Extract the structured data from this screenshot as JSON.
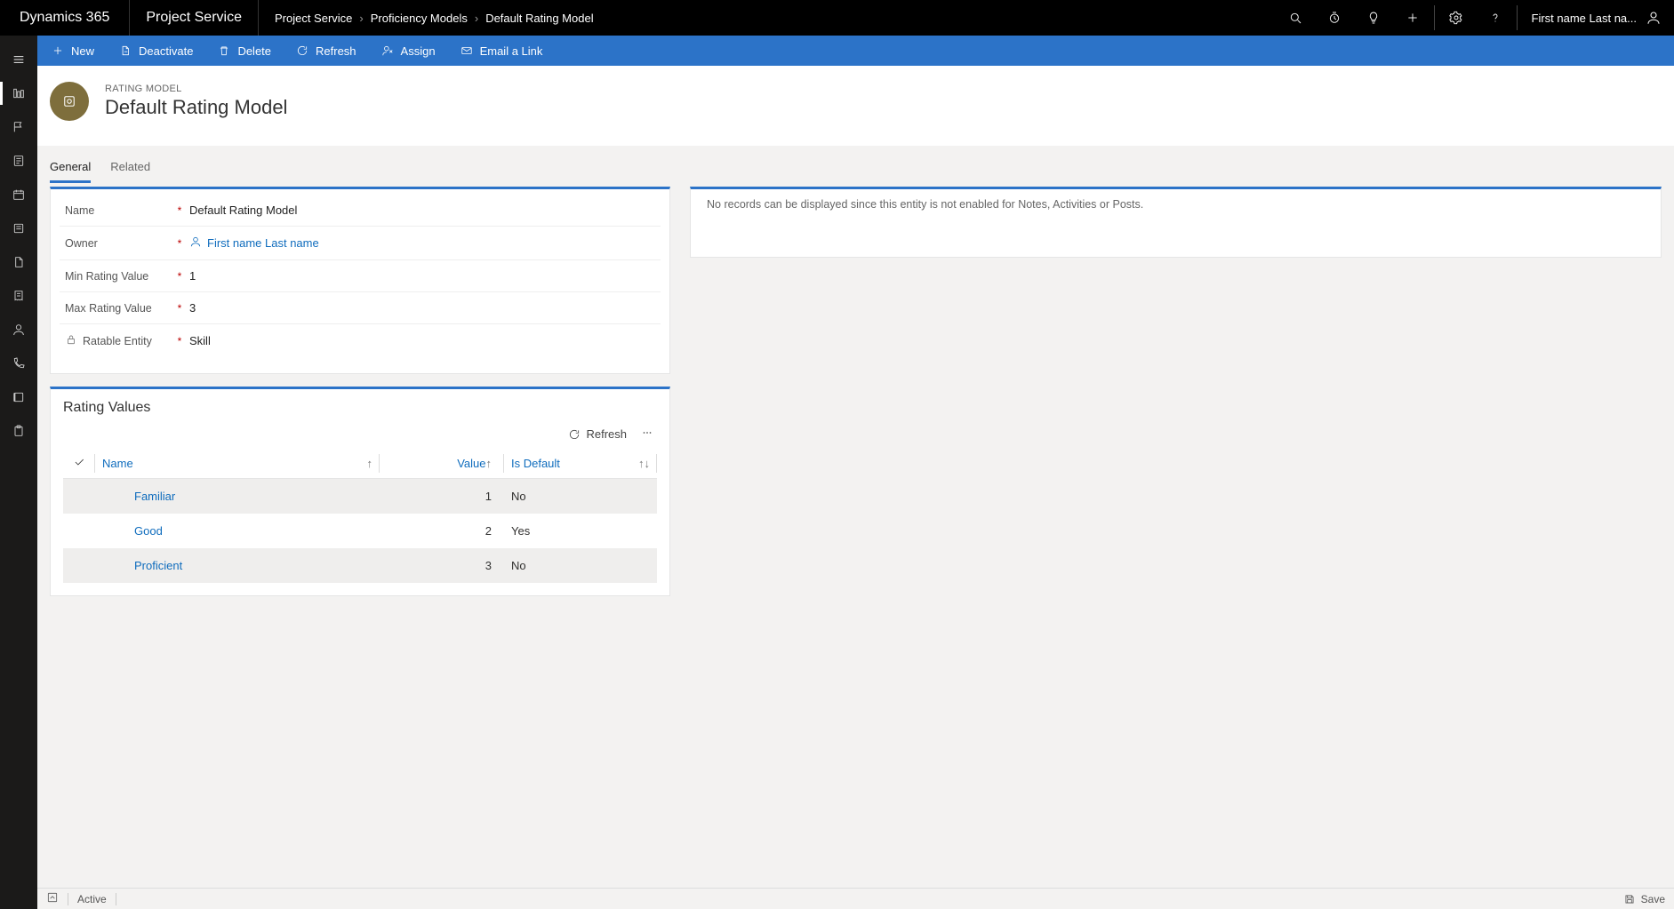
{
  "topbar": {
    "brand": "Dynamics 365",
    "app": "Project Service",
    "breadcrumbs": [
      "Project Service",
      "Proficiency Models",
      "Default Rating Model"
    ],
    "user_name": "First name Last na..."
  },
  "cmdbar": {
    "new": "New",
    "deactivate": "Deactivate",
    "delete": "Delete",
    "refresh": "Refresh",
    "assign": "Assign",
    "email": "Email a Link"
  },
  "header": {
    "eyebrow": "RATING MODEL",
    "title": "Default Rating Model"
  },
  "tabs": {
    "general": "General",
    "related": "Related"
  },
  "fields": {
    "name": {
      "label": "Name",
      "value": "Default Rating Model"
    },
    "owner": {
      "label": "Owner",
      "value": "First name Last name"
    },
    "min_rating": {
      "label": "Min Rating Value",
      "value": "1"
    },
    "max_rating": {
      "label": "Max Rating Value",
      "value": "3"
    },
    "ratable_entity": {
      "label": "Ratable Entity",
      "value": "Skill"
    }
  },
  "right_panel": {
    "empty_message": "No records can be displayed since this entity is not enabled for Notes, Activities or Posts."
  },
  "ratings": {
    "title": "Rating Values",
    "refresh": "Refresh",
    "columns": {
      "name": "Name",
      "value": "Value",
      "is_default": "Is Default"
    },
    "rows": [
      {
        "name": "Familiar",
        "value": "1",
        "is_default": "No"
      },
      {
        "name": "Good",
        "value": "2",
        "is_default": "Yes"
      },
      {
        "name": "Proficient",
        "value": "3",
        "is_default": "No"
      }
    ]
  },
  "footer": {
    "status": "Active",
    "save": "Save"
  }
}
